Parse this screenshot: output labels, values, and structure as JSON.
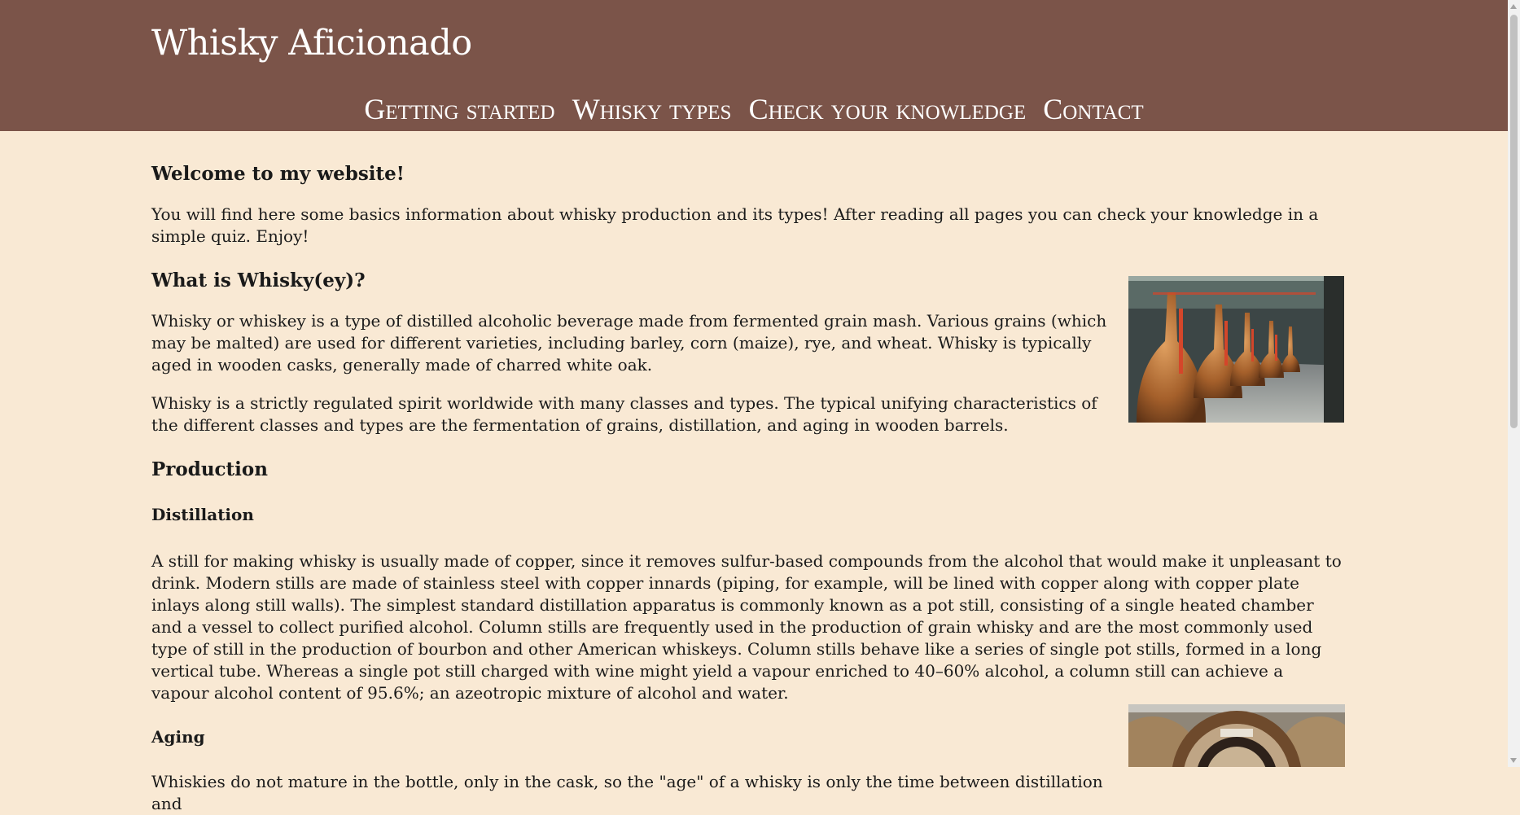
{
  "site": {
    "title": "Whisky Aficionado"
  },
  "nav": {
    "items": [
      {
        "label": "Getting started"
      },
      {
        "label": "Whisky types"
      },
      {
        "label": "Check your knowledge"
      },
      {
        "label": "Contact"
      }
    ]
  },
  "intro": {
    "heading": "Welcome to my website!",
    "text": "You will find here some basics information about whisky production and its types! After reading all pages you can check your knowledge in a simple quiz. Enjoy!"
  },
  "whatis": {
    "heading": "What is Whisky(ey)?",
    "p1": "Whisky or whiskey is a type of distilled alcoholic beverage made from fermented grain mash. Various grains (which may be malted) are used for different varieties, including barley, corn (maize), rye, and wheat. Whisky is typically aged in wooden casks, generally made of charred white oak.",
    "p2": "Whisky is a strictly regulated spirit worldwide with many classes and types. The typical unifying characteristics of the different classes and types are the fermentation of grains, distillation, and aging in wooden barrels."
  },
  "production": {
    "heading": "Production",
    "distillation": {
      "heading": "Distillation",
      "text": "A still for making whisky is usually made of copper, since it removes sulfur-based compounds from the alcohol that would make it unpleasant to drink. Modern stills are made of stainless steel with copper innards (piping, for example, will be lined with copper along with copper plate inlays along still walls). The simplest standard distillation apparatus is commonly known as a pot still, consisting of a single heated chamber and a vessel to collect purified alcohol. Column stills are frequently used in the production of grain whisky and are the most commonly used type of still in the production of bourbon and other American whiskeys. Column stills behave like a series of single pot stills, formed in a long vertical tube. Whereas a single pot still charged with wine might yield a vapour enriched to 40–60% alcohol, a column still can achieve a vapour alcohol content of 95.6%; an azeotropic mixture of alcohol and water."
    },
    "aging": {
      "heading": "Aging",
      "text": "Whiskies do not mature in the bottle, only in the cask, so the \"age\" of a whisky is only the time between distillation and"
    }
  },
  "colors": {
    "header_bg": "#7b5449",
    "page_bg": "#f9e9d4",
    "text": "#1a1a1a",
    "header_text": "#ffffff"
  }
}
